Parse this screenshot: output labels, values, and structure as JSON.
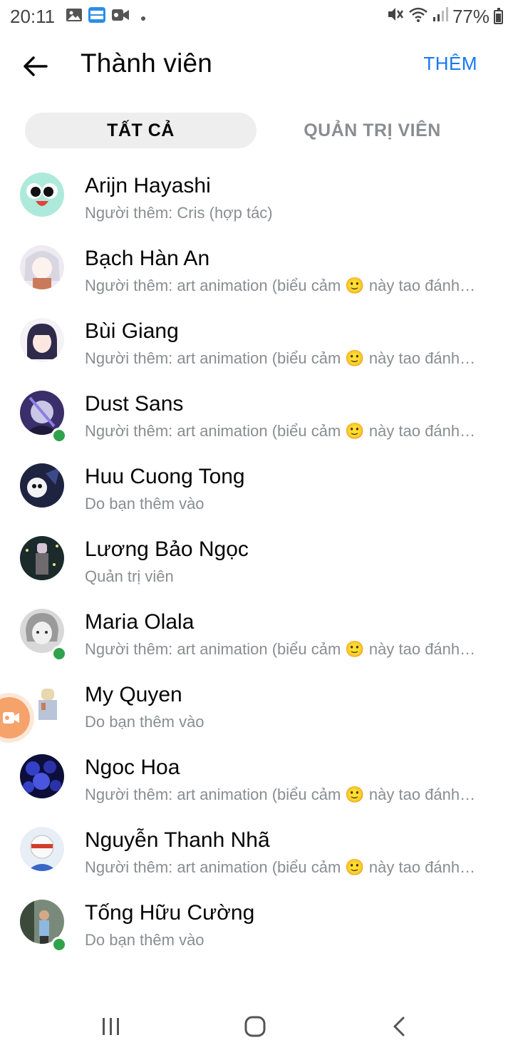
{
  "status_bar": {
    "time": "20:11",
    "battery": "77%",
    "left_icons": [
      "gallery-icon",
      "noveltoon-app-icon",
      "video-record-icon",
      "dot-icon"
    ],
    "right_icons": [
      "mute-icon",
      "wifi-icon",
      "signal-icon",
      "battery-icon"
    ]
  },
  "header": {
    "title": "Thành viên",
    "add_label": "THÊM",
    "accent_color": "#1877f2"
  },
  "tabs": [
    {
      "label": "TẤT CẢ",
      "active": true
    },
    {
      "label": "QUẢN TRỊ VIÊN",
      "active": false
    }
  ],
  "members": [
    {
      "name": "Arijn Hayashi",
      "subtitle": "Người thêm: Cris (hợp tác)",
      "online": false
    },
    {
      "name": "Bạch Hàn An",
      "subtitle": "Người thêm: art animation (biểu cảm 🙂 này tao đánh…",
      "online": false
    },
    {
      "name": "Bùi Giang",
      "subtitle": "Người thêm: art animation (biểu cảm 🙂 này tao đánh…",
      "online": false
    },
    {
      "name": "Dust Sans",
      "subtitle": "Người thêm: art animation (biểu cảm 🙂 này tao đánh…",
      "online": true
    },
    {
      "name": "Huu Cuong Tong",
      "subtitle": "Do bạn thêm vào",
      "online": false
    },
    {
      "name": "Lương Bảo Ngọc",
      "subtitle": "Quản trị viên",
      "online": false
    },
    {
      "name": "Maria Olala",
      "subtitle": "Người thêm: art animation (biểu cảm 🙂 này tao đánh…",
      "online": true
    },
    {
      "name": "My Quyen",
      "subtitle": "Do bạn thêm vào",
      "online": false
    },
    {
      "name": "Ngoc Hoa",
      "subtitle": "Người thêm: art animation (biểu cảm 🙂 này tao đánh…",
      "online": false
    },
    {
      "name": "Nguyễn Thanh Nhã",
      "subtitle": "Người thêm: art animation (biểu cảm 🙂 này tao đánh…",
      "online": false
    },
    {
      "name": "Tống Hữu Cường",
      "subtitle": "Do bạn thêm vào",
      "online": true
    }
  ],
  "online_color": "#31a24c",
  "nav_bar": [
    "recent-apps-icon",
    "home-icon",
    "back-nav-icon"
  ]
}
